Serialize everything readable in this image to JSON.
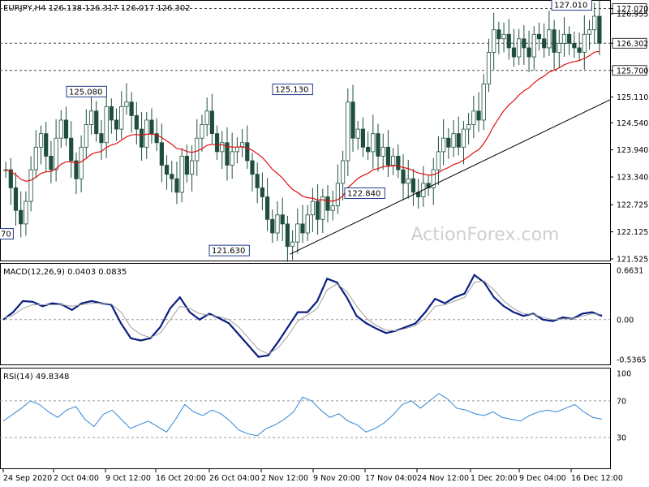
{
  "header": {
    "main": "EURJPY,H4  126.138 126.317 126.017 126.302",
    "macd": "MACD(12,26,9) 0.0403 0.0835",
    "rsi": "RSI(14) 49.8348"
  },
  "watermark": "ActionForex.com",
  "colors": {
    "candle": "#1f4f3c",
    "ma": "#e01010",
    "macd": "#0a1f82",
    "signal": "#a0a0a0",
    "rsi": "#2f86d6",
    "label_border": "#1f3a8a"
  },
  "chart_data": [
    {
      "type": "candlestick",
      "title": "EURJPY,H4",
      "ylim": [
        121.525,
        127.08
      ],
      "yticks": [
        "127.070",
        "126.955",
        "126.302",
        "125.700",
        "125.110",
        "124.540",
        "123.940",
        "123.340",
        "122.725",
        "122.125",
        "121.525"
      ],
      "highlight_levels": [
        127.07,
        126.302,
        125.7
      ],
      "annotations": [
        "127.010",
        "125.080",
        "125.130",
        "122.840",
        "121.630",
        "70"
      ],
      "x_labels": [
        "24 Sep 2020",
        "2 Oct 04:00",
        "9 Oct 12:00",
        "16 Oct 20:00",
        "26 Oct 04:00",
        "2 Nov 12:00",
        "9 Nov 20:00",
        "17 Nov 04:00",
        "24 Nov 12:00",
        "1 Dec 20:00",
        "9 Dec 04:00",
        "16 Dec 12:00"
      ],
      "close": [
        123.5,
        123.1,
        122.6,
        122.3,
        122.8,
        123.5,
        124.0,
        124.3,
        123.8,
        123.5,
        124.2,
        124.6,
        124.2,
        123.7,
        123.3,
        124.0,
        124.5,
        124.8,
        124.3,
        124.1,
        124.9,
        124.6,
        124.4,
        124.9,
        125.0,
        124.7,
        124.4,
        124.0,
        124.6,
        124.3,
        124.1,
        123.6,
        123.4,
        123.3,
        123.0,
        123.8,
        123.4,
        123.7,
        124.2,
        124.5,
        124.8,
        124.3,
        123.9,
        124.1,
        123.6,
        123.9,
        124.0,
        124.1,
        123.7,
        123.4,
        123.1,
        122.9,
        122.4,
        122.1,
        122.5,
        122.3,
        121.8,
        121.9,
        122.3,
        122.1,
        122.5,
        122.8,
        122.4,
        122.9,
        122.6,
        122.7,
        123.2,
        123.7,
        125.0,
        124.2,
        124.4,
        124.0,
        123.9,
        124.3,
        123.8,
        124.0,
        123.6,
        123.8,
        123.5,
        123.2,
        123.3,
        123.0,
        122.9,
        123.2,
        123.1,
        123.5,
        123.9,
        124.2,
        124.0,
        124.3,
        124.0,
        124.4,
        124.5,
        124.8,
        124.6,
        125.4,
        126.1,
        126.6,
        126.4,
        126.5,
        126.2,
        126.0,
        126.4,
        126.2,
        126.0,
        126.5,
        126.4,
        126.2,
        126.6,
        126.1,
        126.3,
        126.5,
        126.3,
        126.2,
        126.1,
        126.5,
        126.6,
        126.9,
        126.3
      ]
    },
    {
      "type": "line",
      "title": "MACD(12,26,9)",
      "ylim": [
        -0.5365,
        0.6631
      ],
      "yticks": [
        "0.6631",
        "0.00",
        "-0.5365"
      ],
      "series": [
        {
          "name": "MACD",
          "values": [
            0.0,
            0.1,
            0.25,
            0.24,
            0.18,
            0.22,
            0.2,
            0.13,
            0.22,
            0.25,
            0.22,
            0.2,
            -0.05,
            -0.25,
            -0.28,
            -0.25,
            -0.1,
            0.15,
            0.3,
            0.1,
            0.0,
            0.08,
            0.02,
            -0.05,
            -0.2,
            -0.35,
            -0.5,
            -0.48,
            -0.3,
            -0.1,
            0.1,
            0.1,
            0.25,
            0.55,
            0.5,
            0.3,
            0.05,
            -0.05,
            -0.12,
            -0.18,
            -0.15,
            -0.1,
            -0.05,
            0.1,
            0.28,
            0.22,
            0.3,
            0.35,
            0.6,
            0.5,
            0.3,
            0.18,
            0.1,
            0.05,
            0.08,
            0.0,
            -0.02,
            0.03,
            0.01,
            0.08,
            0.1,
            0.05
          ]
        },
        {
          "name": "Signal",
          "values": [
            0.02,
            0.06,
            0.15,
            0.2,
            0.2,
            0.2,
            0.2,
            0.18,
            0.2,
            0.22,
            0.22,
            0.21,
            0.1,
            -0.1,
            -0.2,
            -0.24,
            -0.18,
            0.0,
            0.18,
            0.15,
            0.08,
            0.06,
            0.04,
            0.0,
            -0.1,
            -0.25,
            -0.4,
            -0.46,
            -0.38,
            -0.22,
            -0.02,
            0.06,
            0.15,
            0.4,
            0.48,
            0.38,
            0.18,
            0.02,
            -0.08,
            -0.14,
            -0.15,
            -0.12,
            -0.08,
            0.02,
            0.18,
            0.2,
            0.25,
            0.3,
            0.5,
            0.52,
            0.4,
            0.25,
            0.15,
            0.08,
            0.07,
            0.03,
            0.0,
            0.01,
            0.01,
            0.05,
            0.08,
            0.07
          ]
        }
      ]
    },
    {
      "type": "line",
      "title": "RSI(14)",
      "ylim": [
        0,
        100
      ],
      "yticks": [
        "100",
        "70",
        "30"
      ],
      "series": [
        {
          "name": "RSI",
          "values": [
            48,
            55,
            62,
            70,
            66,
            58,
            52,
            60,
            64,
            50,
            42,
            55,
            60,
            50,
            40,
            44,
            48,
            42,
            36,
            50,
            66,
            58,
            54,
            60,
            56,
            48,
            38,
            34,
            32,
            40,
            44,
            50,
            58,
            74,
            70,
            60,
            52,
            56,
            48,
            44,
            36,
            40,
            46,
            55,
            66,
            70,
            62,
            70,
            78,
            72,
            62,
            60,
            56,
            54,
            58,
            52,
            50,
            48,
            54,
            58,
            60,
            58,
            62,
            66,
            58,
            52,
            50
          ]
        }
      ]
    }
  ]
}
